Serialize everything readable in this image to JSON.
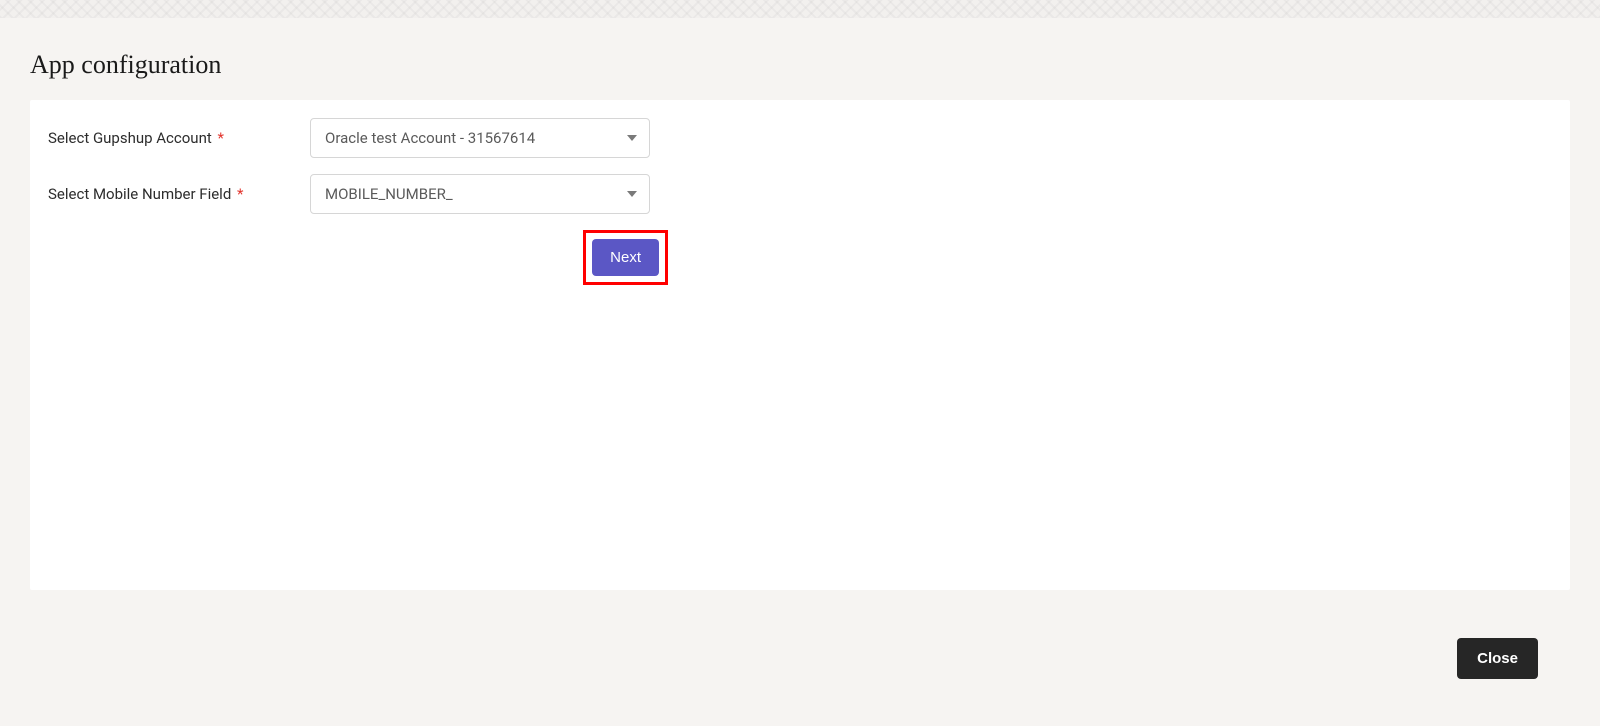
{
  "page": {
    "title": "App configuration"
  },
  "form": {
    "account": {
      "label": "Select Gupshup Account",
      "value": "Oracle test Account - 31567614"
    },
    "mobile_field": {
      "label": "Select Mobile Number Field",
      "value": "MOBILE_NUMBER_"
    }
  },
  "buttons": {
    "next": "Next",
    "close": "Close"
  }
}
